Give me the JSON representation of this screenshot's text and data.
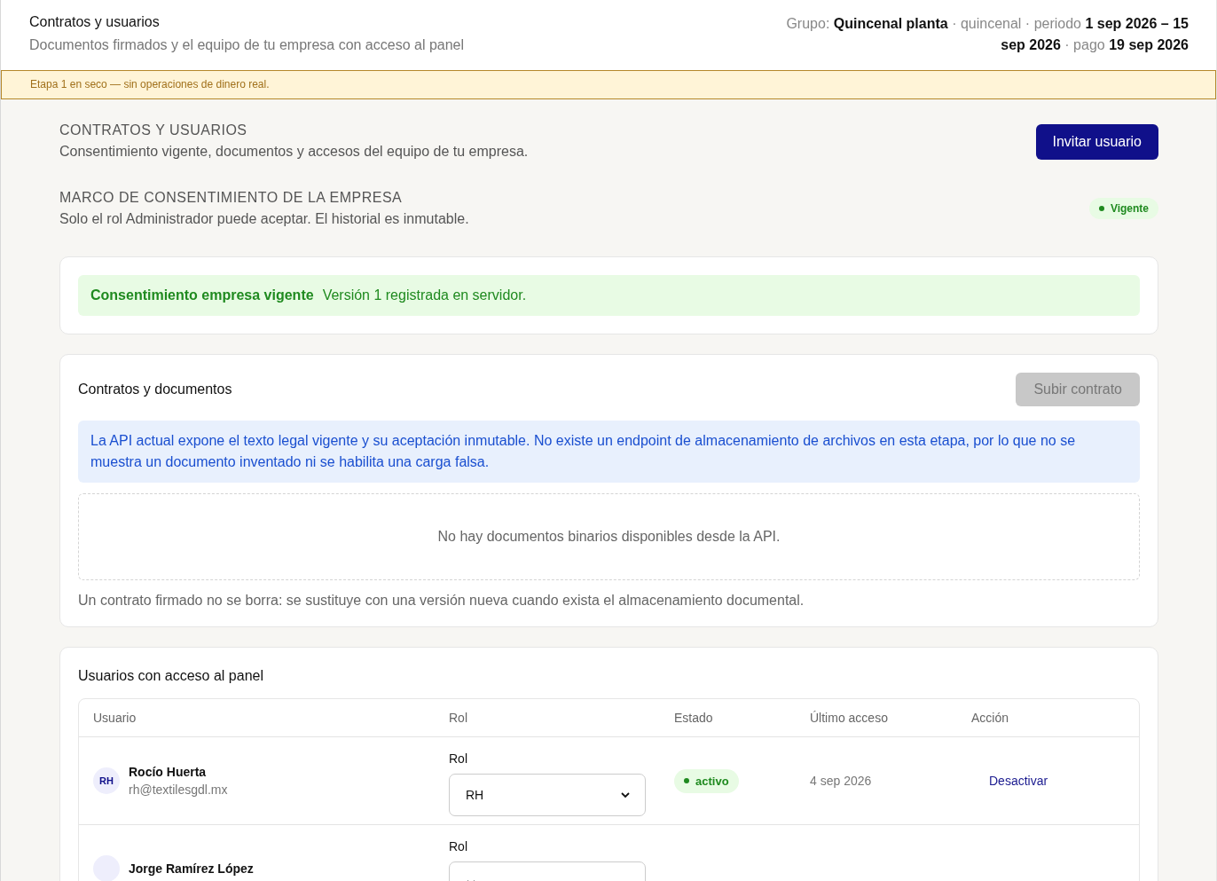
{
  "header": {
    "title": "Contratos y usuarios",
    "subtitle": "Documentos firmados y el equipo de tu empresa con acceso al panel",
    "meta": "Grupo: **Quincenal planta** · quincenal · periodo **1 sep 2026 – 15 sep 2026** · pago **19 sep 2026**"
  },
  "banner": "Etapa 1 en seco — sin operaciones de dinero real.",
  "section": {
    "title": "CONTRATOS Y USUARIOS",
    "subtitle": "Consentimiento vigente, documentos y accesos del equipo de tu empresa.",
    "button": "Invitar usuario"
  },
  "framework": {
    "title": "MARCO DE CONSENTIMIENTO DE LA EMPRESA",
    "subtitle": "Solo el rol Administrador puede aceptar. El historial es inmutable.",
    "badge": "Vigente"
  },
  "consent": {
    "title": "Consentimiento empresa vigente",
    "text": "Versión 1 registrada en servidor."
  },
  "contracts": {
    "title": "Contratos y documentos",
    "button": "Subir contrato",
    "button_disabled": true,
    "info": "La API actual expone el texto legal vigente y su aceptación inmutable. No existe un endpoint de almacenamiento de archivos en esta etapa, por lo que no se muestra un documento inventado ni se habilita una carga falsa.",
    "empty": "No hay documentos binarios disponibles desde la API.",
    "note": "Un contrato firmado no se borra: se sustituye con una versión nueva cuando exista el almacenamiento documental."
  },
  "users": {
    "title": "Usuarios con acceso al panel",
    "columns": [
      "Usuario",
      "Rol",
      "Estado",
      "Último acceso",
      "Acción"
    ],
    "rows": [
      {
        "initials": "RH",
        "name": "Rocío Huerta",
        "email": "rh@textilesgdl.mx",
        "role_label": "Rol",
        "role": "RH",
        "status": "activo",
        "last_access": "4 sep 2026",
        "action": "Desactivar"
      },
      {
        "name": "Jorge Ramírez López",
        "role_label": "Rol"
      }
    ]
  }
}
